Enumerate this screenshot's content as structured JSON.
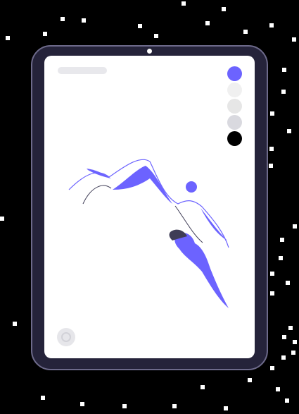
{
  "colors": {
    "background": "#000000",
    "device_frame": "#25233a",
    "screen": "#ffffff",
    "accent": "#6c63ff",
    "dark": "#3f3d56"
  },
  "palette": {
    "swatches": [
      {
        "name": "purple",
        "color": "#6c63ff",
        "selected": true
      },
      {
        "name": "light-gray",
        "color": "#f0f0f0",
        "selected": false
      },
      {
        "name": "gray",
        "color": "#e6e6e6",
        "selected": false
      },
      {
        "name": "medium-gray",
        "color": "#d9d9df",
        "selected": false
      },
      {
        "name": "black",
        "color": "#000000",
        "selected": false
      }
    ]
  },
  "icons": {
    "home": "home-button-icon",
    "camera": "front-camera-icon"
  }
}
